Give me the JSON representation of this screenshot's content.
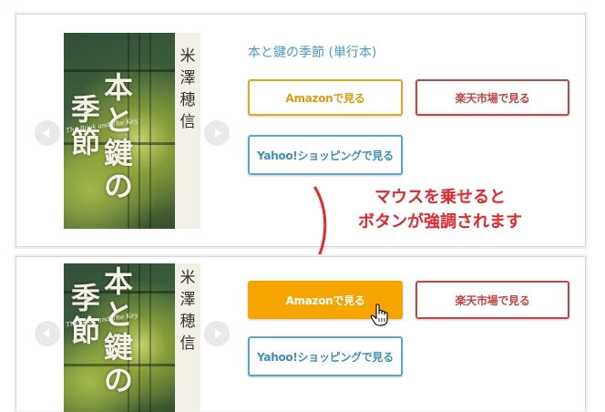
{
  "card_top": {
    "book_title": "本と鍵の季節 (単行本)",
    "cover": {
      "title_chars": [
        "本",
        "と",
        "鍵",
        "の",
        "季",
        "節"
      ],
      "author_chars": [
        "米",
        "澤",
        "穂",
        "信"
      ],
      "english_title": "The Book and The Key"
    },
    "buttons": {
      "amazon": "Amazonで見る",
      "rakuten": "楽天市場で見る",
      "yahoo": "Yahoo!ショッピングで見る"
    }
  },
  "annotation": {
    "line1": "マウスを乗せると",
    "line2": "ボタンが強調されます",
    "color": "#e8262d"
  },
  "card_bottom": {
    "cover": {
      "title_chars": [
        "本",
        "と",
        "鍵",
        "の",
        "季",
        "節"
      ],
      "author_chars": [
        "米",
        "澤",
        "穂",
        "信"
      ],
      "english_title": "The Book and The Key"
    },
    "buttons": {
      "amazon": "Amazonで見る",
      "rakuten": "楽天市場で見る",
      "yahoo": "Yahoo!ショッピングで見る"
    }
  },
  "colors": {
    "amazon": "#f5a400",
    "rakuten": "#c04545",
    "yahoo": "#5aa6cc",
    "title": "#4a9bc4"
  }
}
